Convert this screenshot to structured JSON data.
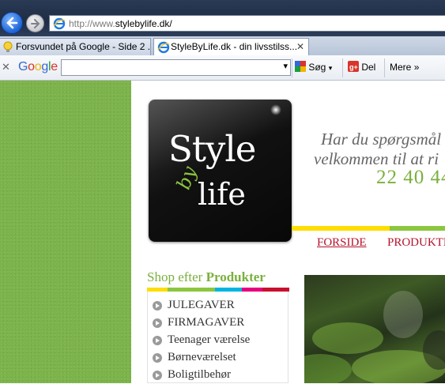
{
  "browser": {
    "address_scheme": "http://www.",
    "address_host": "stylebylife.dk/",
    "tabs": [
      {
        "label": "Forsvundet på Google - Side 2 ..."
      },
      {
        "label": "StyleByLife.dk - din livsstilss..."
      }
    ],
    "tab_close": "✕"
  },
  "google_toolbar": {
    "close": "✕",
    "logo": "Google",
    "search_value": "",
    "dropdown": "▾",
    "search_label": "Søg",
    "share_label": "Del",
    "more_label": "Mere",
    "more_chevron": "»",
    "colors": {
      "blue": "#3568d4",
      "red": "#d9342b",
      "yellow": "#f2b400",
      "green": "#1a9d41"
    }
  },
  "page": {
    "logo": {
      "style": "Style",
      "by": "by",
      "life": "life"
    },
    "tagline_line1": "Har du spørgsmål",
    "tagline_line2": "velkommen til at ri",
    "phone": "22 40 44",
    "nav": {
      "forside": "FORSIDE",
      "produkter": "PRODUKTE"
    },
    "shop_heading_prefix": "Shop efter ",
    "shop_heading_bold": "Produkter",
    "categories": [
      "JULEGAVER",
      "FIRMAGAVER",
      "Teenager værelse",
      "Børneværelset",
      "Boligtilbehør"
    ],
    "stripe_colors": [
      "#ffdd00",
      "#8cc63f",
      "#00b5e2",
      "#e5007e",
      "#c8102e"
    ],
    "accent_green": "#7ab03e",
    "nav_red": "#b5122b"
  }
}
